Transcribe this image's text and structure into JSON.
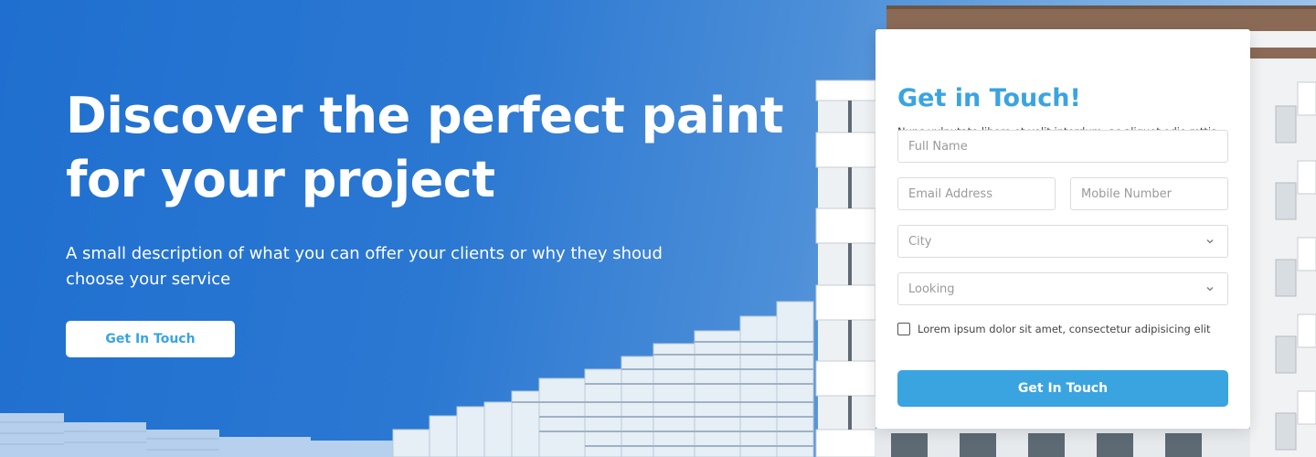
{
  "hero": {
    "title_line1": "Discover the perfect paint",
    "title_line2": "for your project",
    "description": "A small description of what you can offer your clients or why they shoud choose your service",
    "cta_label": "Get In Touch"
  },
  "form": {
    "title": "Get in Touch!",
    "subtitle": "Nunc vulputate libero et velit interdum, ac aliquet odio mttis.",
    "full_name_placeholder": "Full Name",
    "email_placeholder": "Email Address",
    "mobile_placeholder": "Mobile Number",
    "city_placeholder": "City",
    "looking_placeholder": "Looking",
    "checkbox_label": "Lorem ipsum dolor sit amet, consectetur adipisicing elit",
    "submit_label": "Get In Touch"
  },
  "colors": {
    "accent": "#3aa4e0",
    "sky_dark": "#1f6fd0",
    "sky_light": "#a9cbee"
  }
}
